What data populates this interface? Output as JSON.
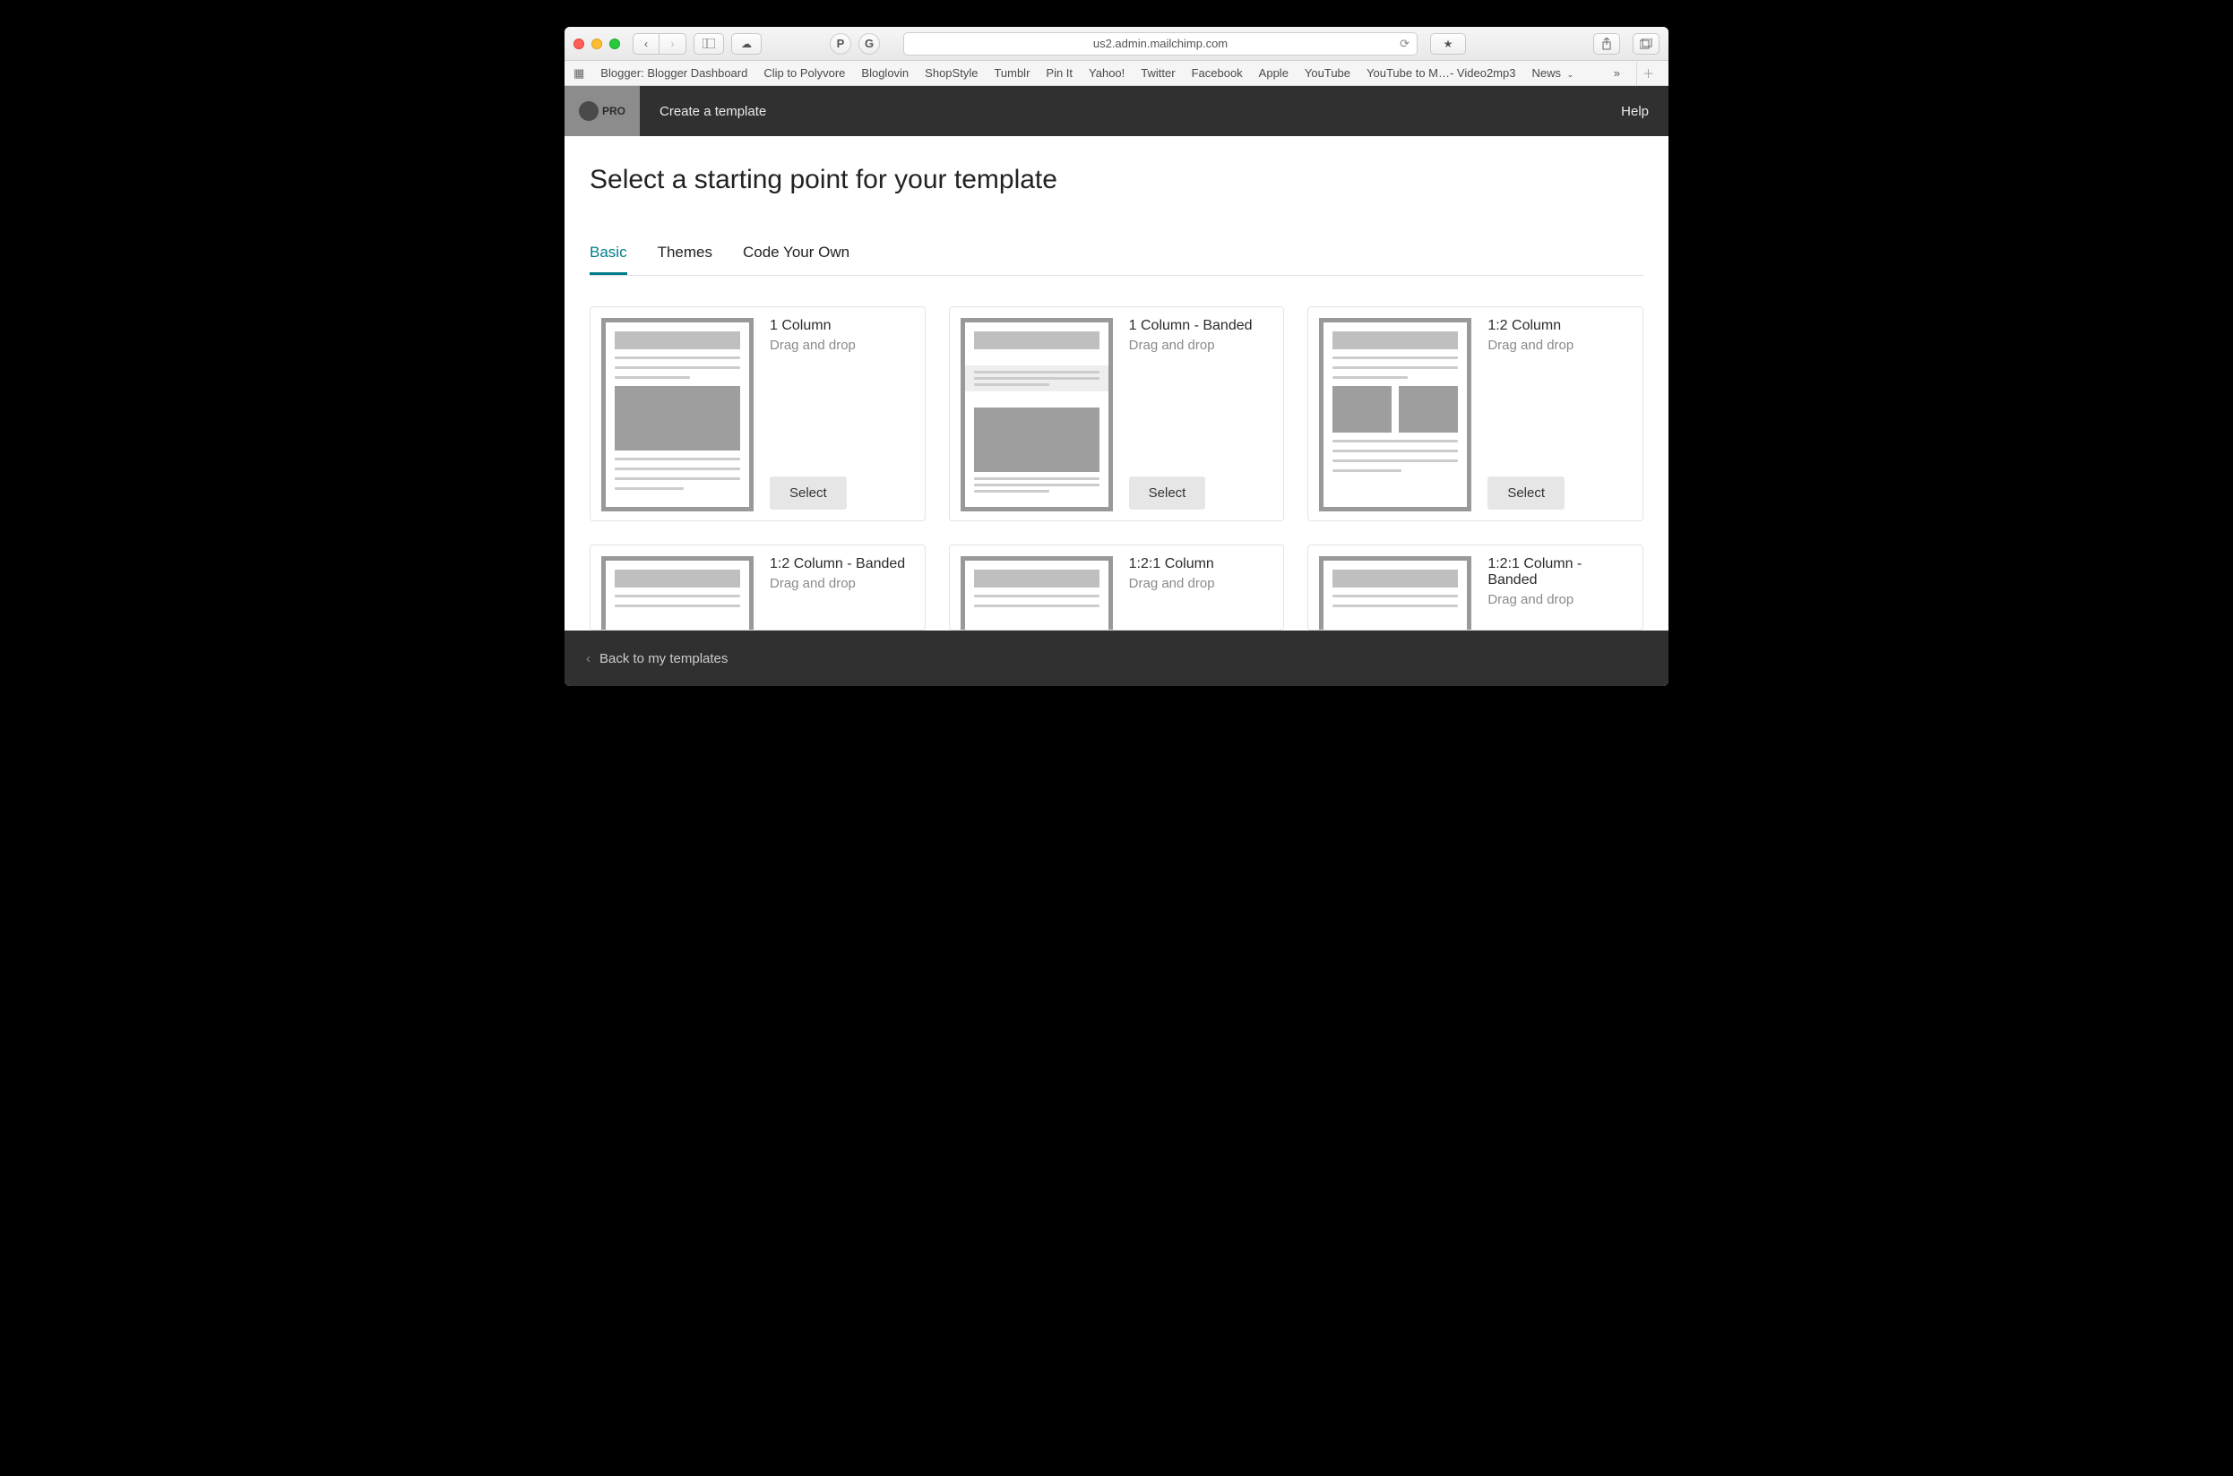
{
  "browser": {
    "address": "us2.admin.mailchimp.com",
    "bookmarks": [
      "Blogger: Blogger Dashboard",
      "Clip to Polyvore",
      "Bloglovin",
      "ShopStyle",
      "Tumblr",
      "Pin It",
      "Yahoo!",
      "Twitter",
      "Facebook",
      "Apple",
      "YouTube",
      "YouTube to M…- Video2mp3",
      "News"
    ]
  },
  "header": {
    "pro_label": "PRO",
    "title": "Create a template",
    "help": "Help"
  },
  "page": {
    "title": "Select a starting point for your template",
    "tabs": [
      "Basic",
      "Themes",
      "Code Your Own"
    ],
    "active_tab": 0,
    "select_label": "Select",
    "templates": [
      {
        "name": "1 Column",
        "sub": "Drag and drop"
      },
      {
        "name": "1 Column - Banded",
        "sub": "Drag and drop"
      },
      {
        "name": "1:2 Column",
        "sub": "Drag and drop"
      },
      {
        "name": "1:2 Column - Banded",
        "sub": "Drag and drop"
      },
      {
        "name": "1:2:1 Column",
        "sub": "Drag and drop"
      },
      {
        "name": "1:2:1 Column - Banded",
        "sub": "Drag and drop"
      }
    ]
  },
  "footer": {
    "back": "Back to my templates"
  }
}
